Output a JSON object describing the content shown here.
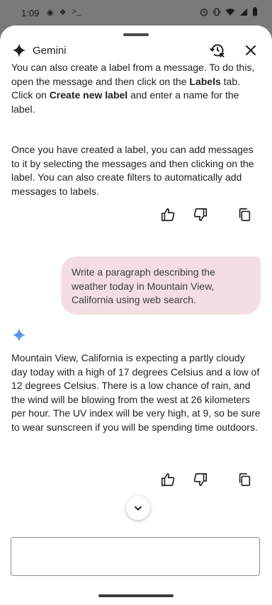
{
  "status_bar": {
    "time": "1:09"
  },
  "header": {
    "title": "Gemini"
  },
  "messages": {
    "response1": {
      "p1_a": "You can also create a label from a message. To do this, open the message and then click on the ",
      "p1_b": "Labels",
      "p1_c": " tab. Click on ",
      "p1_d": "Create new label",
      "p1_e": " and enter a name for the label.",
      "p2": "Once you have created a label, you can add messages to it by selecting the messages and then clicking on the label. You can also create filters to automatically add messages to labels."
    },
    "user_prompt": "Write a paragraph describing the weather today in Mountain View, California using web search.",
    "response2": "Mountain View, California is expecting a partly cloudy day today with a high of 17 degrees Celsius and a low of 12 degrees Celsius. There is a low chance of rain, and the wind will be blowing from the west at 26 kilometers per hour. The UV index will be very high, at 9, so be sure to wear sunscreen if you will be spending time outdoors."
  },
  "input": {
    "value": "",
    "placeholder": ""
  },
  "colors": {
    "user_bubble": "#f3dfe1",
    "gemini_blue": "#4a7fe8"
  }
}
